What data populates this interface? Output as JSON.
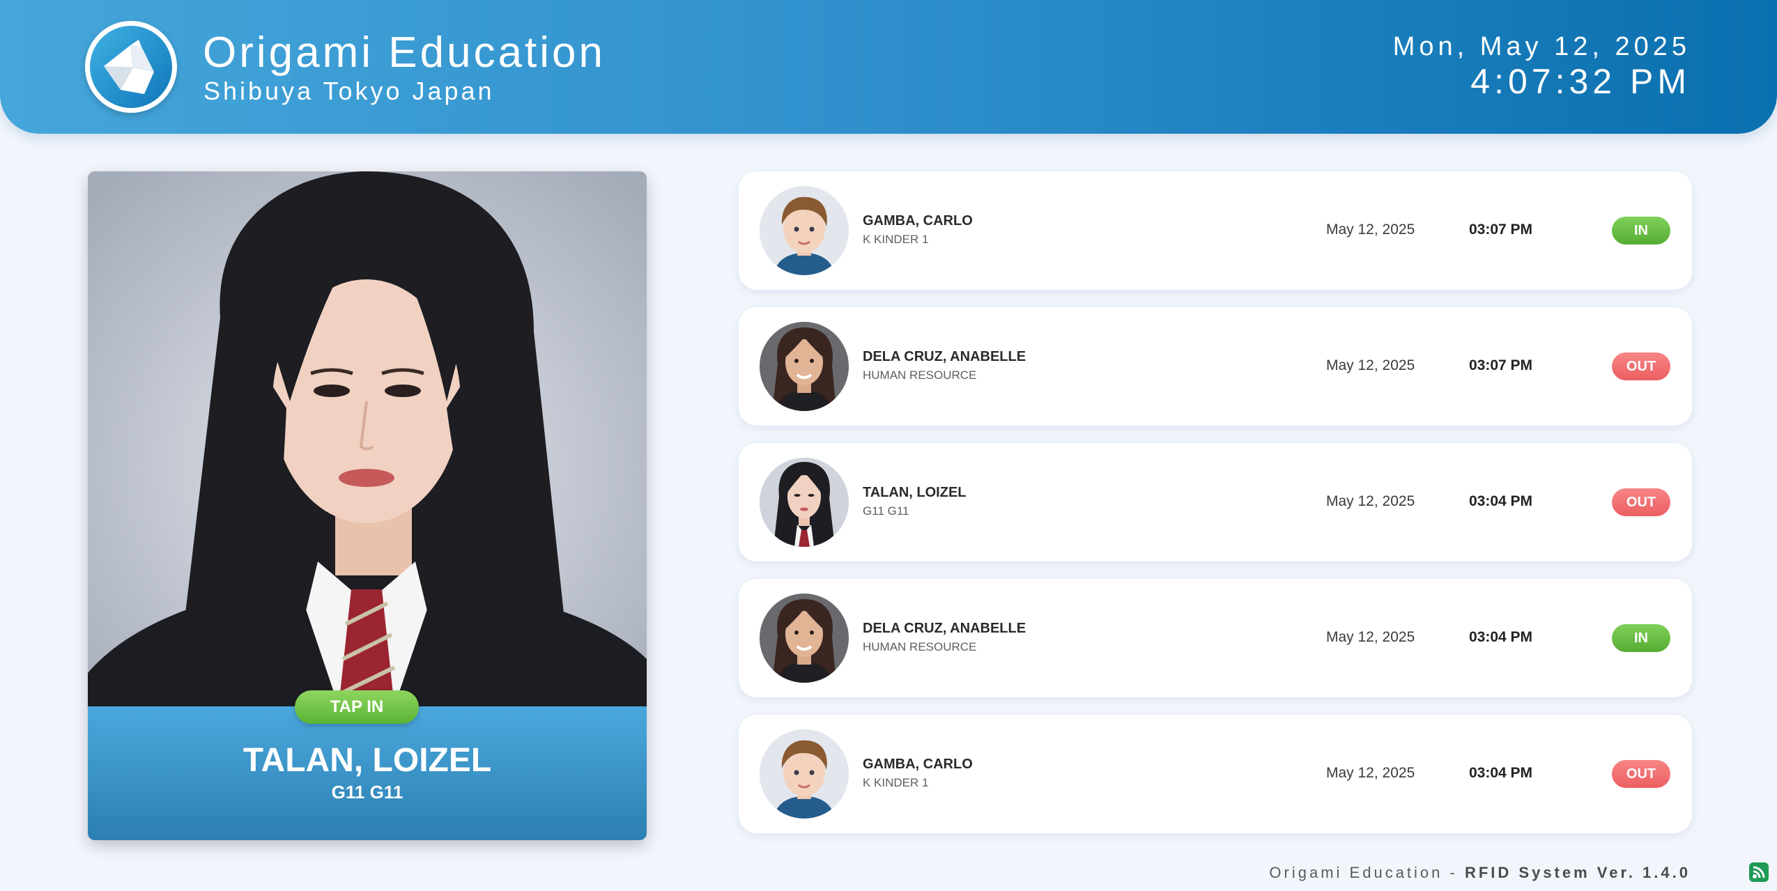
{
  "header": {
    "title": "Origami Education",
    "subtitle": "Shibuya Tokyo Japan",
    "date": "Mon, May 12, 2025",
    "time": "4:07:32 PM",
    "logo_icon": "origami-crane-icon"
  },
  "featured": {
    "tap_label": "TAP IN",
    "name": "TALAN, LOIZEL",
    "grade": "G11 G11"
  },
  "logs": [
    {
      "name": "GAMBA, CARLO",
      "dept": "K KINDER 1",
      "date": "May 12, 2025",
      "time": "03:07 PM",
      "status": "IN"
    },
    {
      "name": "DELA CRUZ, ANABELLE",
      "dept": "HUMAN RESOURCE",
      "date": "May 12, 2025",
      "time": "03:07 PM",
      "status": "OUT"
    },
    {
      "name": "TALAN, LOIZEL",
      "dept": "G11 G11",
      "date": "May 12, 2025",
      "time": "03:04 PM",
      "status": "OUT"
    },
    {
      "name": "DELA CRUZ, ANABELLE",
      "dept": "HUMAN RESOURCE",
      "date": "May 12, 2025",
      "time": "03:04 PM",
      "status": "IN"
    },
    {
      "name": "GAMBA, CARLO",
      "dept": "K KINDER 1",
      "date": "May 12, 2025",
      "time": "03:04 PM",
      "status": "OUT"
    }
  ],
  "footer": {
    "brand": "Origami Education",
    "separator": " - ",
    "system": "RFID System Ver. 1.4.0"
  },
  "colors": {
    "header_start": "#45a6da",
    "header_end": "#0a6fae",
    "status_in": "#5bb435",
    "status_out": "#ec5f62"
  }
}
